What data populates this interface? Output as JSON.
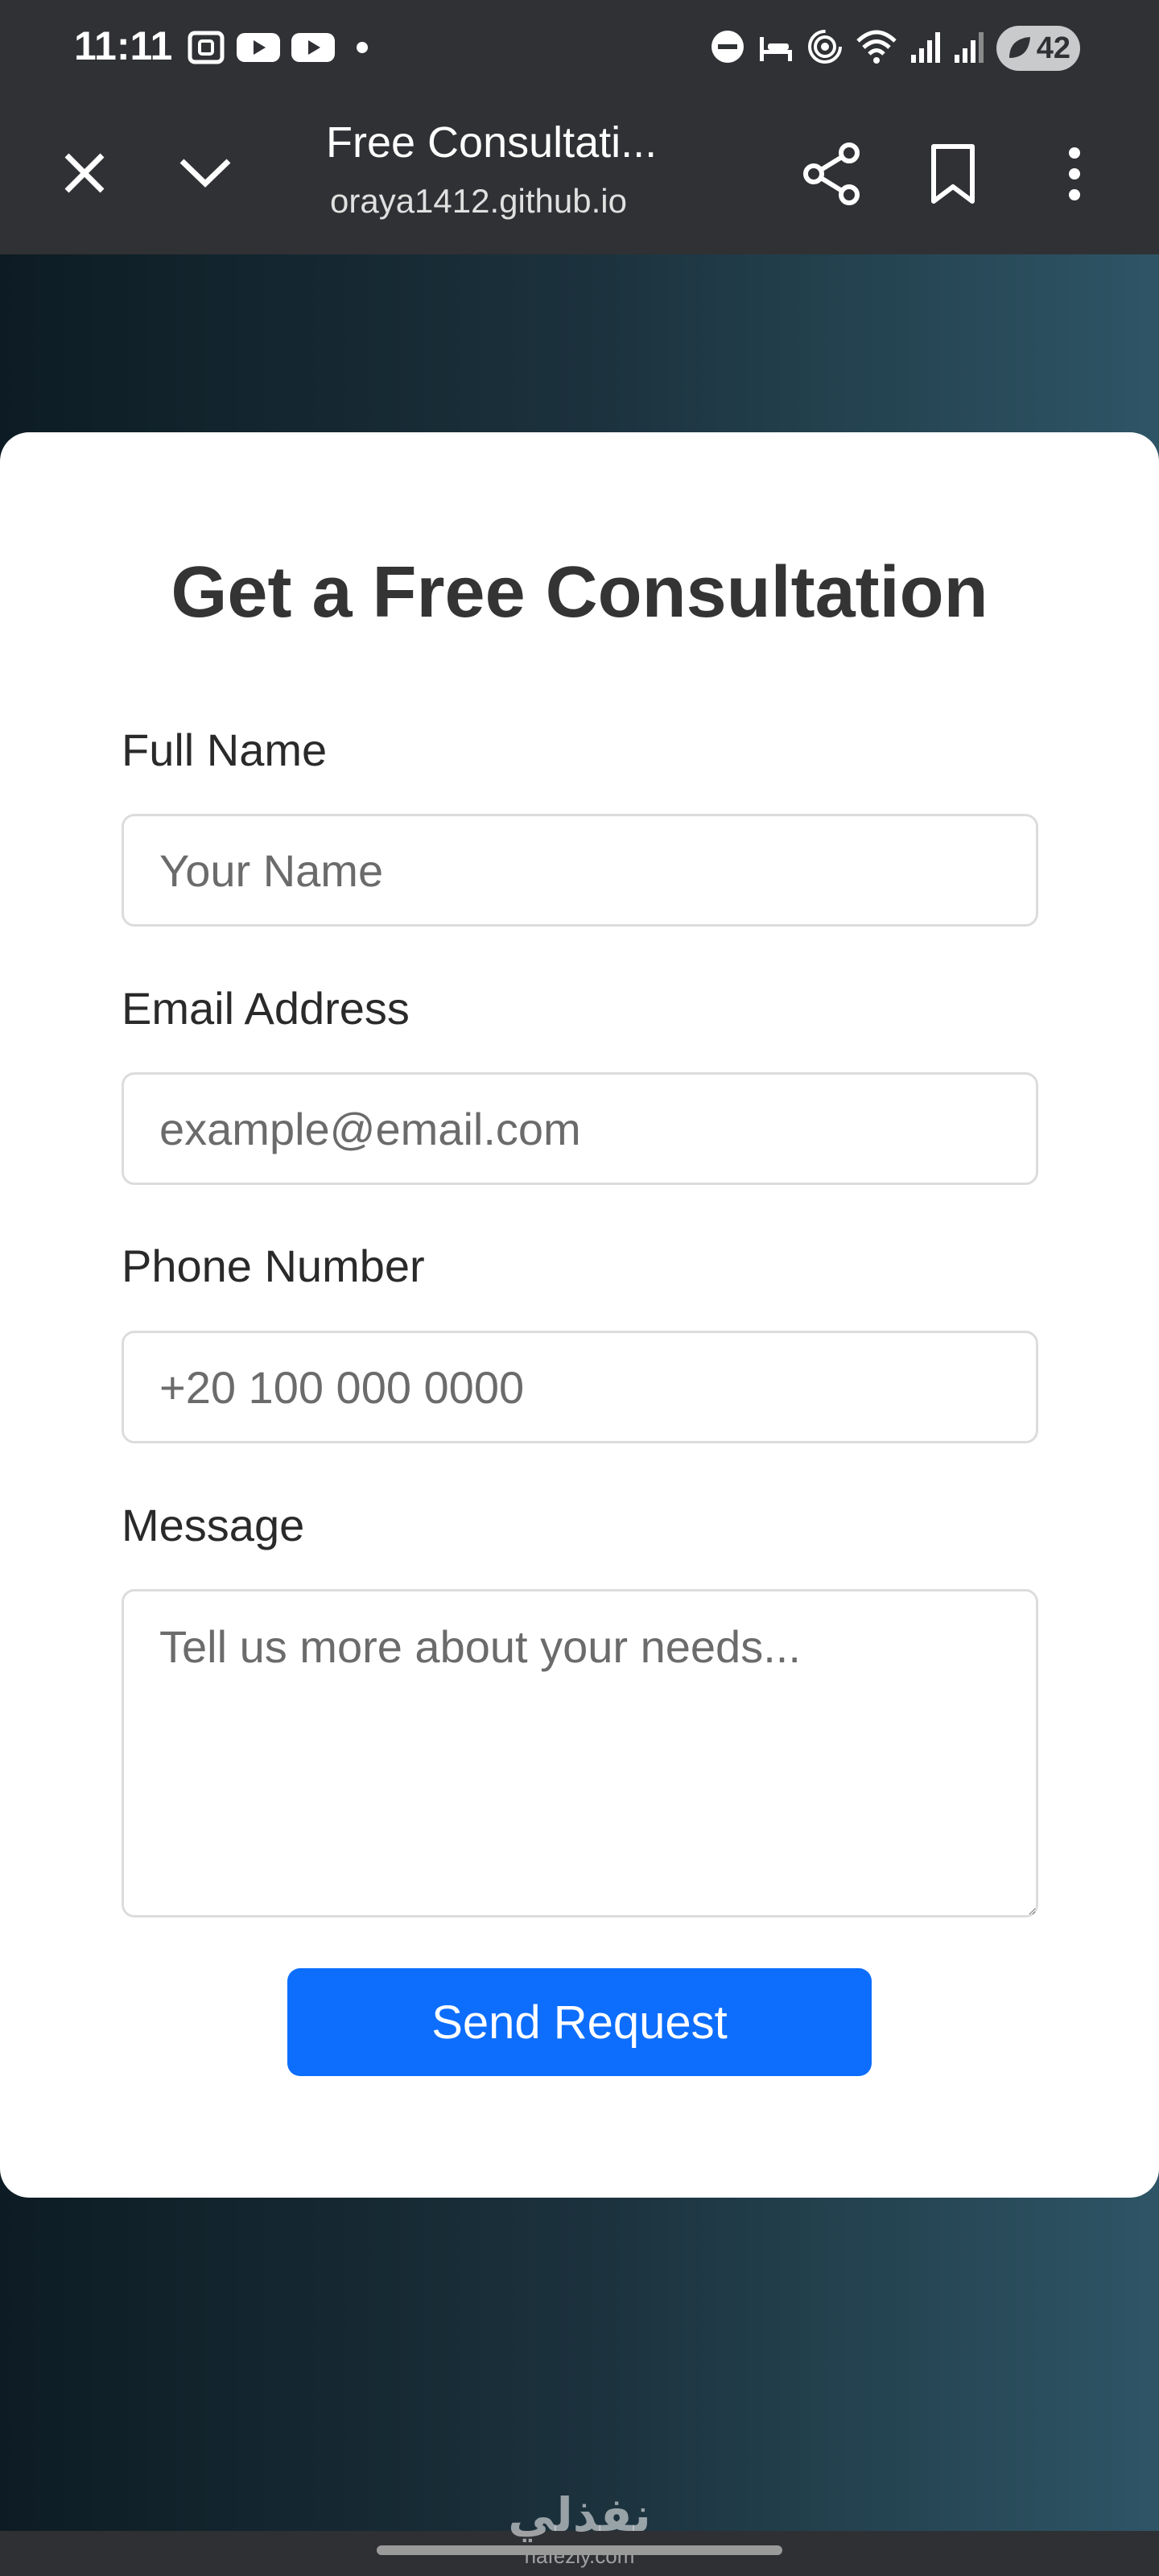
{
  "status_bar": {
    "time": "11:11",
    "battery": "42",
    "left_icons": [
      "screenshot-icon",
      "youtube-icon",
      "youtube-icon",
      "notification-dot-icon"
    ],
    "right_icons": [
      "do-not-disturb-icon",
      "bedtime-icon",
      "hotspot-icon",
      "wifi-icon",
      "signal-icon",
      "signal-icon",
      "battery-icon"
    ]
  },
  "browser": {
    "title": "Free Consultati...",
    "url": "oraya1412.github.io",
    "icons": [
      "close-icon",
      "chevron-down-icon",
      "share-icon",
      "bookmark-icon",
      "more-vert-icon"
    ]
  },
  "form": {
    "title": "Get a Free Consultation",
    "name_label": "Full Name",
    "name_placeholder": "Your Name",
    "email_label": "Email Address",
    "email_placeholder": "example@email.com",
    "phone_label": "Phone Number",
    "phone_placeholder": "+20 100 000 0000",
    "message_label": "Message",
    "message_placeholder": "Tell us more about your needs...",
    "submit_label": "Send Request"
  },
  "colors": {
    "button": "#0d6efd",
    "toolbar": "#303134",
    "gradient_start": "#0d1c24",
    "gradient_end": "#2e5566"
  },
  "watermark": {
    "arabic": "نفذلي",
    "latin": "nafezly.com"
  }
}
